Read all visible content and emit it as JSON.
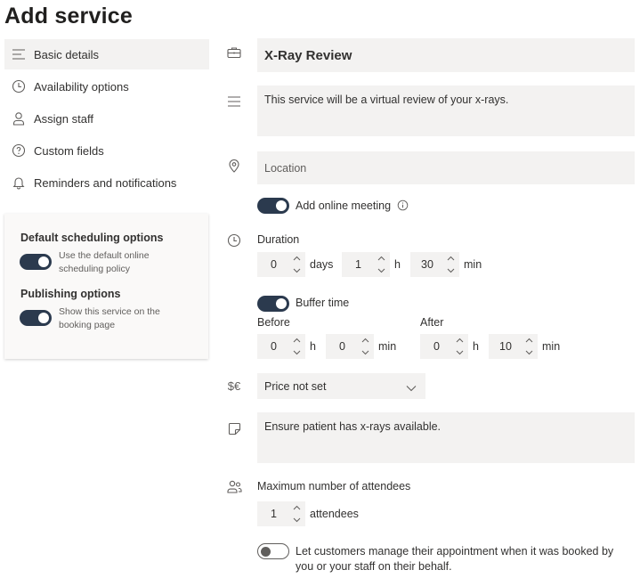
{
  "page": {
    "title": "Add service"
  },
  "nav": {
    "items": [
      {
        "label": "Basic details",
        "icon": "lines-icon",
        "active": true
      },
      {
        "label": "Availability options",
        "icon": "clock-icon"
      },
      {
        "label": "Assign staff",
        "icon": "person-icon"
      },
      {
        "label": "Custom fields",
        "icon": "question-icon"
      },
      {
        "label": "Reminders and notifications",
        "icon": "bell-icon"
      }
    ]
  },
  "options_card": {
    "default_scheduling": {
      "heading": "Default scheduling options",
      "description": "Use the default online scheduling policy",
      "on": true
    },
    "publishing": {
      "heading": "Publishing options",
      "description": "Show this service on the booking page",
      "on": true
    }
  },
  "form": {
    "service_name": "X-Ray Review",
    "description": "This service will be a virtual review of your x-rays.",
    "location_placeholder": "Location",
    "online_meeting": {
      "label": "Add online meeting",
      "on": true
    },
    "duration": {
      "label": "Duration",
      "days": "0",
      "days_unit": "days",
      "hours": "1",
      "hours_unit": "h",
      "minutes": "30",
      "minutes_unit": "min"
    },
    "buffer": {
      "label": "Buffer time",
      "on": true,
      "before": {
        "label": "Before",
        "hours": "0",
        "hours_unit": "h",
        "minutes": "0",
        "minutes_unit": "min"
      },
      "after": {
        "label": "After",
        "hours": "0",
        "hours_unit": "h",
        "minutes": "10",
        "minutes_unit": "min"
      }
    },
    "price": {
      "selected": "Price not set"
    },
    "notes": "Ensure patient has x-rays available.",
    "attendees": {
      "label": "Maximum number of attendees",
      "value": "1",
      "unit": "attendees"
    },
    "manage": {
      "label": "Let customers manage their appointment when it was booked by you or your staff on their behalf.",
      "on": false
    }
  },
  "colors": {
    "toggle_on": "#2b3a4e",
    "field_bg": "#f3f2f1",
    "nav_active_bg": "#f3f2f1"
  }
}
